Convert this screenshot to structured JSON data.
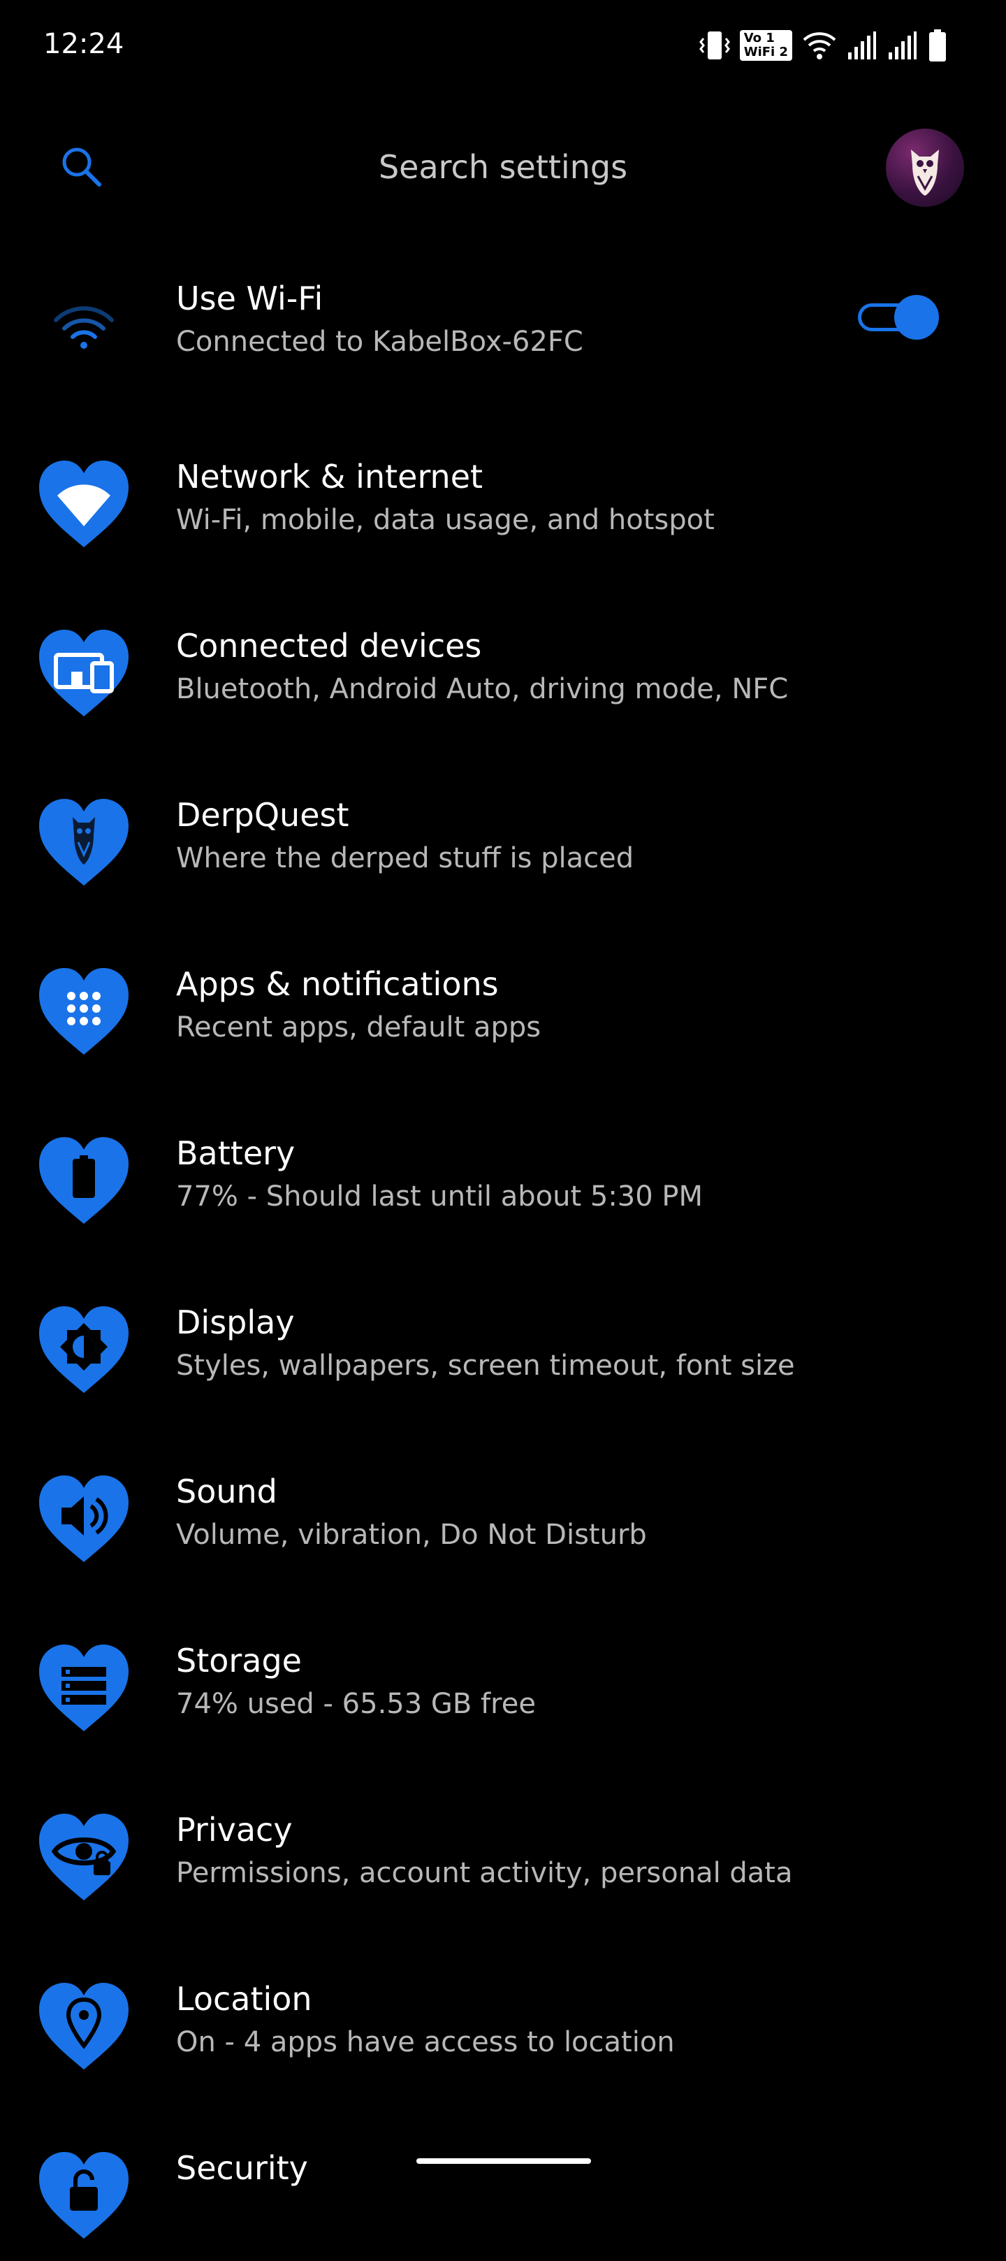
{
  "status_bar": {
    "time": "12:24",
    "volte_top": "Vo 1",
    "volte_bottom": "WiFi 2",
    "icons": [
      "vibrate-icon",
      "volte-wifi-icon",
      "wifi-signal-icon",
      "cell-signal-1-icon",
      "cell-signal-2-icon",
      "battery-icon"
    ]
  },
  "search": {
    "placeholder": "Search settings"
  },
  "accent_color": "#1a73e8",
  "wifi_row": {
    "title": "Use Wi-Fi",
    "subtitle": "Connected to KabelBox-62FC",
    "toggle_on": true
  },
  "items": [
    {
      "title": "Network & internet",
      "subtitle": "Wi-Fi, mobile, data usage, and hotspot",
      "icon": "wifi-icon"
    },
    {
      "title": "Connected devices",
      "subtitle": "Bluetooth, Android Auto, driving mode, NFC",
      "icon": "devices-icon"
    },
    {
      "title": "DerpQuest",
      "subtitle": "Where the derped stuff is placed",
      "icon": "owl-icon"
    },
    {
      "title": "Apps & notifications",
      "subtitle": "Recent apps, default apps",
      "icon": "apps-grid-icon"
    },
    {
      "title": "Battery",
      "subtitle": "77% - Should last until about 5:30 PM",
      "icon": "battery-icon"
    },
    {
      "title": "Display",
      "subtitle": "Styles, wallpapers, screen timeout, font size",
      "icon": "brightness-icon"
    },
    {
      "title": "Sound",
      "subtitle": "Volume, vibration, Do Not Disturb",
      "icon": "volume-icon"
    },
    {
      "title": "Storage",
      "subtitle": "74% used - 65.53 GB free",
      "icon": "storage-icon"
    },
    {
      "title": "Privacy",
      "subtitle": "Permissions, account activity, personal data",
      "icon": "privacy-eye-icon"
    },
    {
      "title": "Location",
      "subtitle": "On - 4 apps have access to location",
      "icon": "location-pin-icon"
    },
    {
      "title": "Security",
      "subtitle": "",
      "icon": "lock-icon"
    }
  ]
}
